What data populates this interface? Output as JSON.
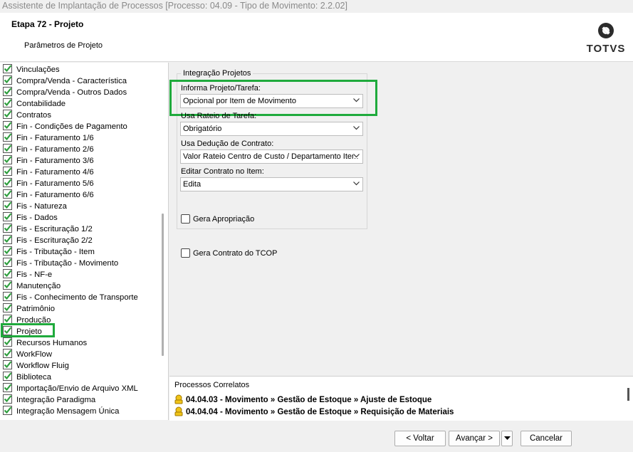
{
  "window": {
    "title": "Assistente de Implantação de Processos [Processo: 04.09 - Tipo de Movimento: 2.2.02]"
  },
  "header": {
    "step_title": "Etapa 72 - Projeto",
    "step_subtitle": "Parâmetros de Projeto",
    "logo_text": "TOTVS"
  },
  "sidebar": {
    "items": [
      "Vinculações",
      "Compra/Venda - Característica",
      "Compra/Venda - Outros Dados",
      "Contabilidade",
      "Contratos",
      "Fin - Condições de Pagamento",
      "Fin - Faturamento 1/6",
      "Fin - Faturamento 2/6",
      "Fin - Faturamento 3/6",
      "Fin - Faturamento 4/6",
      "Fin - Faturamento 5/6",
      "Fin - Faturamento 6/6",
      "Fis - Natureza",
      "Fis - Dados",
      "Fis - Escrituração 1/2",
      "Fis - Escrituração 2/2",
      "Fis - Tributação - Item",
      "Fis - Tributação - Movimento",
      "Fis - NF-e",
      "Manutenção",
      "Fis - Conhecimento de Transporte",
      "Patrimônio",
      "Produção",
      "Projeto",
      "Recursos Humanos",
      "WorkFlow",
      "Workflow Fluig",
      "Biblioteca",
      "Importação/Envio de Arquivo XML",
      "Integração Paradigma",
      "Integração Mensagem Única"
    ],
    "selected": "Projeto"
  },
  "form": {
    "group_title": "Integração Projetos",
    "informa_label": "Informa Projeto/Tarefa:",
    "informa_value": "Opcional por Item de Movimento",
    "rateio_label": "Usa Rateio de Tarefa:",
    "rateio_value": "Obrigatório",
    "deducao_label": "Usa Dedução de Contrato:",
    "deducao_value": "Valor Rateio Centro de Custo / Departamento Item",
    "editar_label": "Editar Contrato no Item:",
    "editar_value": "Edita",
    "gera_apropriacao": "Gera Apropriação",
    "gera_contrato": "Gera Contrato do TCOP"
  },
  "related": {
    "title": "Processos Correlatos",
    "items": [
      "04.04.03 - Movimento » Gestão de Estoque » Ajuste de Estoque",
      "04.04.04 - Movimento » Gestão de Estoque » Requisição de Materiais"
    ]
  },
  "buttons": {
    "back": "< Voltar",
    "next": "Avançar >",
    "cancel": "Cancelar"
  },
  "colors": {
    "highlight": "#1faa3c",
    "check_green": "#2e9e3e"
  }
}
